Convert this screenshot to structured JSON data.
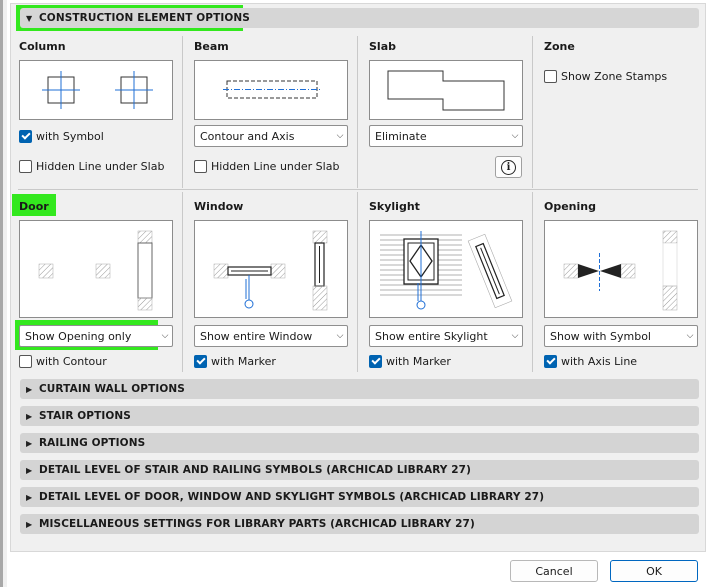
{
  "sections": {
    "construction_title": "CONSTRUCTION ELEMENT OPTIONS",
    "collapsed": [
      "CURTAIN WALL OPTIONS",
      "STAIR OPTIONS",
      "RAILING OPTIONS",
      "DETAIL LEVEL OF STAIR AND RAILING SYMBOLS (ARCHICAD LIBRARY 27)",
      "DETAIL LEVEL OF DOOR, WINDOW AND SKYLIGHT SYMBOLS (ARCHICAD LIBRARY 27)",
      "MISCELLANEOUS SETTINGS FOR LIBRARY PARTS (ARCHICAD LIBRARY 27)"
    ]
  },
  "column": {
    "title": "Column",
    "with_symbol": "with Symbol",
    "with_symbol_checked": true,
    "hidden_line": "Hidden Line under Slab",
    "hidden_line_checked": false
  },
  "beam": {
    "title": "Beam",
    "dropdown": "Contour and Axis",
    "hidden_line": "Hidden Line under Slab",
    "hidden_line_checked": false
  },
  "slab": {
    "title": "Slab",
    "dropdown": "Eliminate",
    "info": "i"
  },
  "zone": {
    "title": "Zone",
    "show_stamps": "Show Zone Stamps",
    "show_stamps_checked": false
  },
  "door": {
    "title": "Door",
    "dropdown": "Show Opening only",
    "with_contour": "with Contour",
    "with_contour_checked": false
  },
  "window": {
    "title": "Window",
    "dropdown": "Show entire Window",
    "with_marker": "with Marker",
    "with_marker_checked": true
  },
  "skylight": {
    "title": "Skylight",
    "dropdown": "Show entire Skylight",
    "with_marker": "with Marker",
    "with_marker_checked": true
  },
  "opening": {
    "title": "Opening",
    "dropdown": "Show with Symbol",
    "with_axis": "with Axis Line",
    "with_axis_checked": true
  },
  "buttons": {
    "cancel": "Cancel",
    "ok": "OK"
  },
  "colors": {
    "highlight": "#33e81e",
    "accent": "#0063b1",
    "axis": "#1f6fd6"
  }
}
